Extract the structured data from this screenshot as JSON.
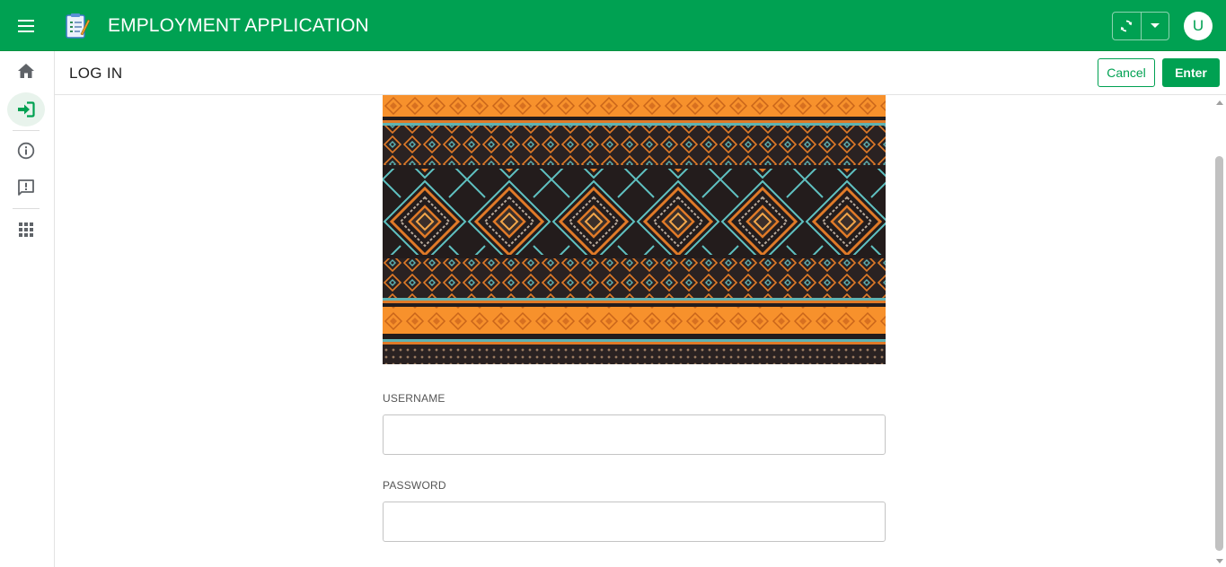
{
  "app": {
    "title": "EMPLOYMENT APPLICATION",
    "brand_color": "#00a152",
    "menu_icon": "hamburger-menu-icon",
    "logo_icon": "application-form-logo-icon",
    "sync_icon": "sync-icon",
    "dropdown_icon": "caret-down-icon",
    "avatar_initial": "U"
  },
  "rail": {
    "items": [
      {
        "name": "home",
        "icon": "home-icon",
        "active": false
      },
      {
        "name": "login",
        "icon": "login-arrow-icon",
        "active": true
      },
      {
        "name": "info",
        "icon": "info-icon",
        "active": false
      },
      {
        "name": "feedback",
        "icon": "feedback-icon",
        "active": false
      },
      {
        "name": "apps",
        "icon": "apps-grid-icon",
        "active": false
      }
    ]
  },
  "page": {
    "title": "LOG IN",
    "cancel_label": "Cancel",
    "enter_label": "Enter"
  },
  "form": {
    "banner": "tribal-pattern-banner",
    "username": {
      "label": "USERNAME",
      "value": "",
      "placeholder": ""
    },
    "password": {
      "label": "PASSWORD",
      "value": "",
      "placeholder": ""
    }
  }
}
